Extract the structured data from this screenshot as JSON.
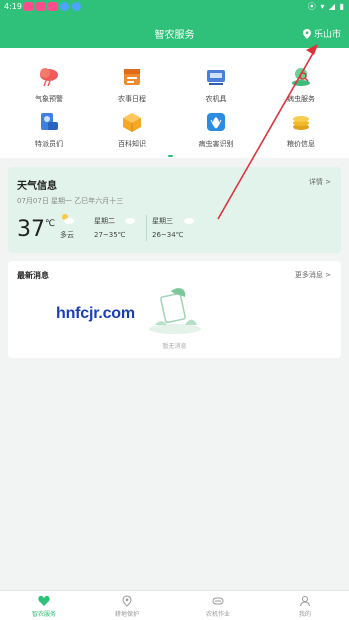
{
  "status_bar": {
    "time": "4:19"
  },
  "header": {
    "title": "智农服务",
    "location": "乐山市"
  },
  "grid_items": [
    {
      "label": "气象预警",
      "icon": "weather-alert-icon"
    },
    {
      "label": "农事日程",
      "icon": "calendar-icon"
    },
    {
      "label": "农机具",
      "icon": "machine-icon"
    },
    {
      "label": "病虫服务",
      "icon": "pest-service-icon"
    },
    {
      "label": "特派员们",
      "icon": "agent-icon"
    },
    {
      "label": "百科知识",
      "icon": "encyclopedia-icon"
    },
    {
      "label": "病虫害识别",
      "icon": "pest-recognition-icon"
    },
    {
      "label": "粮价信息",
      "icon": "grain-price-icon"
    }
  ],
  "weather": {
    "title": "天气信息",
    "detail": "详情 >",
    "date": "07月07日 星期一  乙巳年六月十三",
    "temp": "37",
    "unit": "℃",
    "condition": "多云",
    "days": [
      {
        "name": "星期二",
        "range": "27~35℃"
      },
      {
        "name": "星期三",
        "range": "26~34℃"
      }
    ]
  },
  "news": {
    "title": "最新消息",
    "more": "更多消息 >",
    "empty": "暂无消息"
  },
  "watermark": "hnfcjr.com",
  "tabs": [
    {
      "label": "智农服务"
    },
    {
      "label": "耕地保护"
    },
    {
      "label": "农机作业"
    },
    {
      "label": "我的"
    }
  ],
  "colors": {
    "accent": "#2fc179",
    "arrow": "#e0303a"
  }
}
